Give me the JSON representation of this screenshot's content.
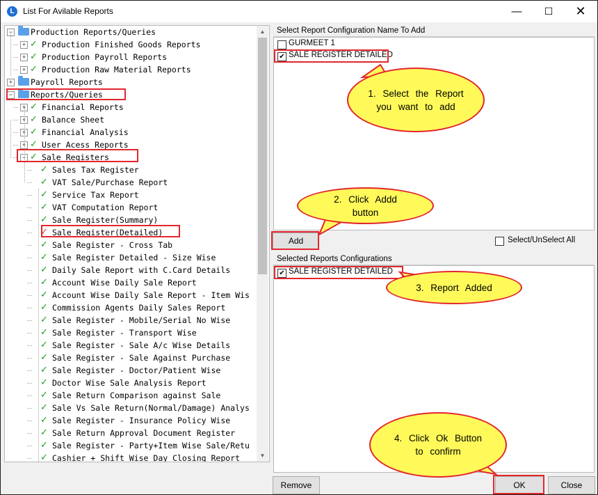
{
  "window": {
    "title": "List For Avilable Reports",
    "icon": "app-icon",
    "controls": {
      "minimize": "—",
      "maximize": "☐",
      "close": "✕"
    }
  },
  "tree": {
    "nodes": [
      {
        "label": "Production Reports/Queries",
        "expander": "−",
        "icon": "folder-icon"
      },
      {
        "label": "Production Finished Goods Reports",
        "expander": "+",
        "icon": "check-icon"
      },
      {
        "label": "Production Payroll Reports",
        "expander": "+",
        "icon": "check-icon"
      },
      {
        "label": "Production Raw Material Reports",
        "expander": "+",
        "icon": "check-icon"
      },
      {
        "label": "Payroll Reports",
        "expander": "+",
        "icon": "folder-icon"
      },
      {
        "label": "Reports/Queries",
        "expander": "−",
        "icon": "folder-icon"
      },
      {
        "label": "Financial Reports",
        "expander": "+",
        "icon": "check-icon"
      },
      {
        "label": "Balance Sheet",
        "expander": "+",
        "icon": "check-icon"
      },
      {
        "label": "Financial Analysis",
        "expander": "+",
        "icon": "check-icon"
      },
      {
        "label": "User Acess Reports",
        "expander": "+",
        "icon": "check-icon"
      },
      {
        "label": "Sale Registers",
        "expander": "−",
        "icon": "check-icon"
      },
      {
        "label": "Sales Tax Register",
        "icon": "check-icon"
      },
      {
        "label": "VAT Sale/Purchase Report",
        "icon": "check-icon"
      },
      {
        "label": "Service Tax Report",
        "icon": "check-icon"
      },
      {
        "label": "VAT Computation Report",
        "icon": "check-icon"
      },
      {
        "label": "Sale Register(Summary)",
        "icon": "check-icon"
      },
      {
        "label": "Sale Register(Detailed)",
        "icon": "check-icon-red"
      },
      {
        "label": "Sale Register - Cross Tab",
        "icon": "check-icon"
      },
      {
        "label": "Sale Register Detailed - Size Wise",
        "icon": "check-icon"
      },
      {
        "label": "Daily Sale Report with C.Card Details",
        "icon": "check-icon"
      },
      {
        "label": "Account Wise Daily Sale Report",
        "icon": "check-icon"
      },
      {
        "label": "Account Wise Daily Sale Report - Item Wis",
        "icon": "check-icon"
      },
      {
        "label": "Commission Agents Daily Sales Report",
        "icon": "check-icon"
      },
      {
        "label": "Sale Register - Mobile/Serial No Wise",
        "icon": "check-icon"
      },
      {
        "label": "Sale Register - Transport Wise",
        "icon": "check-icon"
      },
      {
        "label": "Sale Register - Sale A/c Wise Details",
        "icon": "check-icon"
      },
      {
        "label": "Sale Register - Sale Against Purchase",
        "icon": "check-icon"
      },
      {
        "label": "Sale Register - Doctor/Patient Wise",
        "icon": "check-icon"
      },
      {
        "label": "Doctor Wise Sale Analysis Report",
        "icon": "check-icon"
      },
      {
        "label": "Sale Return Comparison against Sale",
        "icon": "check-icon"
      },
      {
        "label": "Sale Vs Sale Return(Normal/Damage) Analys",
        "icon": "check-icon"
      },
      {
        "label": "Sale Register - Insurance Policy Wise",
        "icon": "check-icon"
      },
      {
        "label": "Sale Return Approval Document Register",
        "icon": "check-icon"
      },
      {
        "label": "Sale Register - Party+Item Wise Sale/Retu",
        "icon": "check-icon"
      },
      {
        "label": "Cashier + Shift Wise Day Closing Report",
        "icon": "check-icon"
      }
    ]
  },
  "config_panel": {
    "header": "Select Report Configuration Name To Add",
    "items": [
      {
        "label": "GURMEET 1",
        "checked": false
      },
      {
        "label": "SALE REGISTER DETAILED",
        "checked": true
      }
    ]
  },
  "add_button": "Add",
  "select_all": {
    "label": "Select/UnSelect All",
    "checked": false
  },
  "selected_panel": {
    "header": "Selected Reports Configurations",
    "items": [
      {
        "label": "SALE REGISTER DETAILED",
        "checked": true
      }
    ]
  },
  "buttons": {
    "remove": "Remove",
    "ok": "OK",
    "close": "Close"
  },
  "callouts": {
    "step1": "1. Select the Report you want to add",
    "step2": "2. Click Addd button",
    "step3": "3. Report Added",
    "step4": "4. Click Ok Button to confirm"
  },
  "colors": {
    "highlight_border": "#e3262d",
    "callout_fill": "#fffa5a",
    "check_green": "#1b9e1b"
  }
}
